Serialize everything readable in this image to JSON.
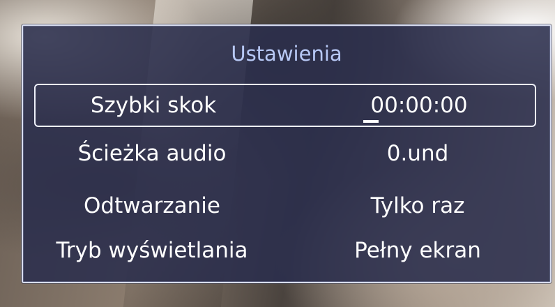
{
  "dialog": {
    "title": "Ustawienia",
    "rows": [
      {
        "label": "Szybki skok",
        "value": "00:00:00"
      },
      {
        "label": "Ścieżka audio",
        "value": "0.und"
      },
      {
        "label": "Odtwarzanie",
        "value": "Tylko raz"
      },
      {
        "label": "Tryb wyświetlania",
        "value": "Pełny ekran"
      }
    ],
    "selected_index": 0
  },
  "colors": {
    "panel_bg": "#2a2e4c",
    "title": "#b8c9f6",
    "text": "#ffffff",
    "border": "#d9def2"
  }
}
